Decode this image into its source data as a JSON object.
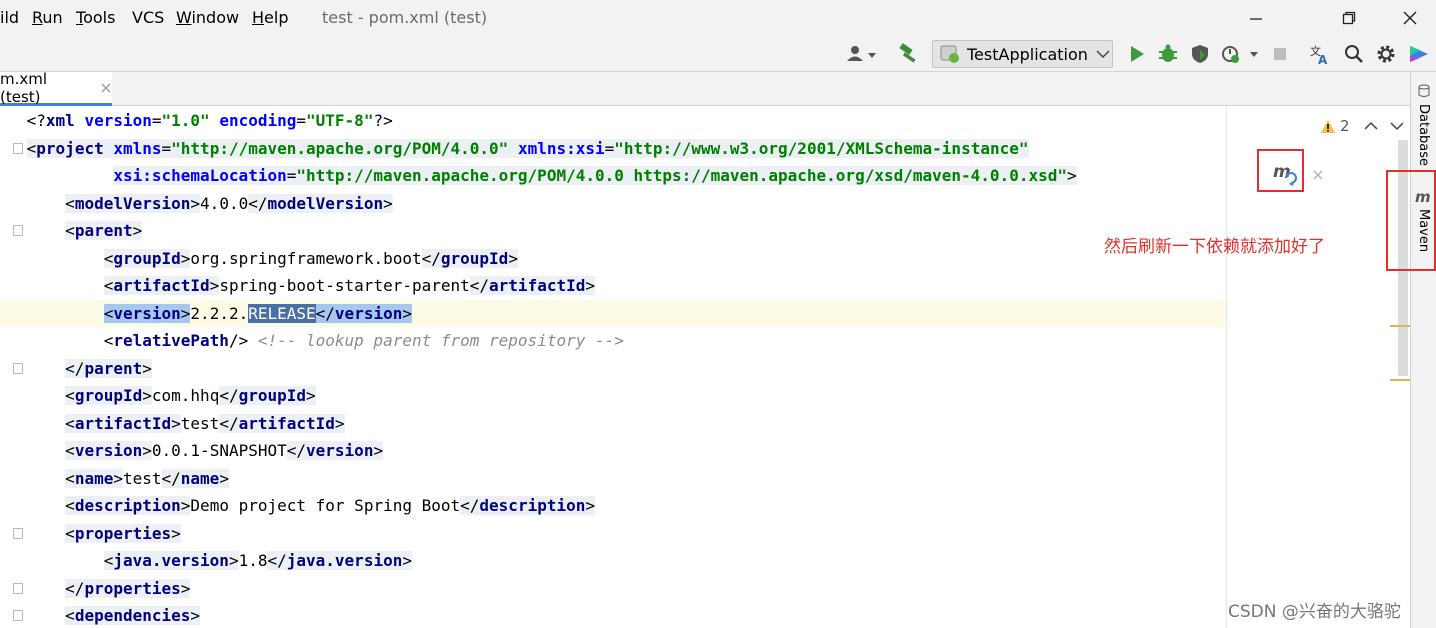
{
  "menubar": {
    "items": [
      {
        "text": "ild",
        "u": ""
      },
      {
        "text": "Run",
        "u": "R"
      },
      {
        "text": "Tools",
        "u": "T"
      },
      {
        "text": "VCS",
        "u": ""
      },
      {
        "text": "Window",
        "u": "W"
      },
      {
        "text": "Help",
        "u": "H"
      }
    ],
    "window_title": "test - pom.xml (test)"
  },
  "toolbar": {
    "run_config": "TestApplication"
  },
  "tab": {
    "label": "m.xml (test)"
  },
  "inspection": {
    "count": "2"
  },
  "right_strip": {
    "database": "Database",
    "maven": "Maven"
  },
  "annotation": "然后刷新一下依赖就添加好了",
  "watermark": "CSDN @兴奋的大骆驼",
  "colors": {
    "accent": "#4083c9",
    "annotation": "#e0302c",
    "tag": "#000080",
    "attr": "#0000ff",
    "value": "#008000"
  },
  "code_lines": [
    {
      "indent": "",
      "segments": [
        {
          "t": "<?",
          "c": "t"
        },
        {
          "t": "xml ",
          "c": "tk"
        },
        {
          "t": "version",
          "c": "an"
        },
        {
          "t": "=",
          "c": "t"
        },
        {
          "t": "\"1.0\" ",
          "c": "av"
        },
        {
          "t": "encoding",
          "c": "an"
        },
        {
          "t": "=",
          "c": "t"
        },
        {
          "t": "\"UTF-8\"",
          "c": "av"
        },
        {
          "t": "?>",
          "c": "t"
        }
      ]
    },
    {
      "indent": "",
      "segments": [
        {
          "t": "<",
          "c": "t hl"
        },
        {
          "t": "project ",
          "c": "tk hl"
        },
        {
          "t": "xmlns",
          "c": "an hl"
        },
        {
          "t": "=",
          "c": "t hl"
        },
        {
          "t": "\"http://maven.apache.org/POM/4.0.0\" ",
          "c": "av hl"
        },
        {
          "t": "xmlns:xsi",
          "c": "an hl"
        },
        {
          "t": "=",
          "c": "t hl"
        },
        {
          "t": "\"http://www.w3.org/2001/XMLSchema-instance\"",
          "c": "av hl"
        }
      ]
    },
    {
      "indent": "         ",
      "segments": [
        {
          "t": "xsi:schemaLocation",
          "c": "an hl"
        },
        {
          "t": "=",
          "c": "t hl"
        },
        {
          "t": "\"http://maven.apache.org/POM/4.0.0 https://maven.apache.org/xsd/maven-4.0.0.xsd\"",
          "c": "av hl"
        },
        {
          "t": ">",
          "c": "t hl"
        }
      ]
    },
    {
      "indent": "    ",
      "segments": [
        {
          "t": "<",
          "c": "t hl"
        },
        {
          "t": "modelVersion",
          "c": "tk hl"
        },
        {
          "t": ">",
          "c": "t hl"
        },
        {
          "t": "4.0.0",
          "c": "t"
        },
        {
          "t": "</",
          "c": "t hl"
        },
        {
          "t": "modelVersion",
          "c": "tk hl"
        },
        {
          "t": ">",
          "c": "t hl"
        }
      ]
    },
    {
      "indent": "    ",
      "segments": [
        {
          "t": "<",
          "c": "t hl"
        },
        {
          "t": "parent",
          "c": "tk hl"
        },
        {
          "t": ">",
          "c": "t hl"
        }
      ]
    },
    {
      "indent": "        ",
      "segments": [
        {
          "t": "<",
          "c": "t hl"
        },
        {
          "t": "groupId",
          "c": "tk hl"
        },
        {
          "t": ">",
          "c": "t hl"
        },
        {
          "t": "org.springframework.boot",
          "c": "t"
        },
        {
          "t": "</",
          "c": "t hl"
        },
        {
          "t": "groupId",
          "c": "tk hl"
        },
        {
          "t": ">",
          "c": "t hl"
        }
      ]
    },
    {
      "indent": "        ",
      "segments": [
        {
          "t": "<",
          "c": "t hl"
        },
        {
          "t": "artifactId",
          "c": "tk hl"
        },
        {
          "t": ">",
          "c": "t hl"
        },
        {
          "t": "spring-boot-starter-parent",
          "c": "t"
        },
        {
          "t": "</",
          "c": "t hl"
        },
        {
          "t": "artifactId",
          "c": "tk hl"
        },
        {
          "t": ">",
          "c": "t hl"
        }
      ]
    },
    {
      "indent": "        ",
      "cur": true,
      "segments": [
        {
          "t": "<",
          "c": "t sel"
        },
        {
          "t": "version",
          "c": "tk sel"
        },
        {
          "t": ">",
          "c": "t sel"
        },
        {
          "t": "2.2.2.",
          "c": "t"
        },
        {
          "t": "RELEASE",
          "c": "selv"
        },
        {
          "t": "</",
          "c": "t sel"
        },
        {
          "t": "version",
          "c": "tk sel"
        },
        {
          "t": ">",
          "c": "t sel"
        }
      ]
    },
    {
      "indent": "        ",
      "segments": [
        {
          "t": "<",
          "c": "t"
        },
        {
          "t": "relativePath",
          "c": "tk"
        },
        {
          "t": "/>",
          "c": "t"
        },
        {
          "t": " <!-- lookup parent from repository -->",
          "c": "cm"
        }
      ]
    },
    {
      "indent": "    ",
      "segments": [
        {
          "t": "</",
          "c": "t hl"
        },
        {
          "t": "parent",
          "c": "tk hl"
        },
        {
          "t": ">",
          "c": "t hl"
        }
      ]
    },
    {
      "indent": "    ",
      "segments": [
        {
          "t": "<",
          "c": "t hl"
        },
        {
          "t": "groupId",
          "c": "tk hl"
        },
        {
          "t": ">",
          "c": "t hl"
        },
        {
          "t": "com.hhq",
          "c": "t"
        },
        {
          "t": "</",
          "c": "t hl"
        },
        {
          "t": "groupId",
          "c": "tk hl"
        },
        {
          "t": ">",
          "c": "t hl"
        }
      ]
    },
    {
      "indent": "    ",
      "segments": [
        {
          "t": "<",
          "c": "t hl"
        },
        {
          "t": "artifactId",
          "c": "tk hl"
        },
        {
          "t": ">",
          "c": "t hl"
        },
        {
          "t": "test",
          "c": "t"
        },
        {
          "t": "</",
          "c": "t hl"
        },
        {
          "t": "artifactId",
          "c": "tk hl"
        },
        {
          "t": ">",
          "c": "t hl"
        }
      ]
    },
    {
      "indent": "    ",
      "segments": [
        {
          "t": "<",
          "c": "t hl"
        },
        {
          "t": "version",
          "c": "tk hl"
        },
        {
          "t": ">",
          "c": "t hl"
        },
        {
          "t": "0.0.1-SNAPSHOT",
          "c": "t"
        },
        {
          "t": "</",
          "c": "t hl"
        },
        {
          "t": "version",
          "c": "tk hl"
        },
        {
          "t": ">",
          "c": "t hl"
        }
      ]
    },
    {
      "indent": "    ",
      "segments": [
        {
          "t": "<",
          "c": "t hl"
        },
        {
          "t": "name",
          "c": "tk hl"
        },
        {
          "t": ">",
          "c": "t hl"
        },
        {
          "t": "test",
          "c": "t"
        },
        {
          "t": "</",
          "c": "t hl"
        },
        {
          "t": "name",
          "c": "tk hl"
        },
        {
          "t": ">",
          "c": "t hl"
        }
      ]
    },
    {
      "indent": "    ",
      "segments": [
        {
          "t": "<",
          "c": "t hl"
        },
        {
          "t": "description",
          "c": "tk hl"
        },
        {
          "t": ">",
          "c": "t hl"
        },
        {
          "t": "Demo project for Spring Boot",
          "c": "t"
        },
        {
          "t": "</",
          "c": "t hl"
        },
        {
          "t": "description",
          "c": "tk hl"
        },
        {
          "t": ">",
          "c": "t hl"
        }
      ]
    },
    {
      "indent": "    ",
      "segments": [
        {
          "t": "<",
          "c": "t hl"
        },
        {
          "t": "properties",
          "c": "tk hl"
        },
        {
          "t": ">",
          "c": "t hl"
        }
      ]
    },
    {
      "indent": "        ",
      "segments": [
        {
          "t": "<",
          "c": "t hl"
        },
        {
          "t": "java.version",
          "c": "tk hl"
        },
        {
          "t": ">",
          "c": "t hl"
        },
        {
          "t": "1.8",
          "c": "t"
        },
        {
          "t": "</",
          "c": "t hl"
        },
        {
          "t": "java.version",
          "c": "tk hl"
        },
        {
          "t": ">",
          "c": "t hl"
        }
      ]
    },
    {
      "indent": "    ",
      "segments": [
        {
          "t": "</",
          "c": "t hl"
        },
        {
          "t": "properties",
          "c": "tk hl"
        },
        {
          "t": ">",
          "c": "t hl"
        }
      ]
    },
    {
      "indent": "    ",
      "segments": [
        {
          "t": "<",
          "c": "t hl"
        },
        {
          "t": "dependencies",
          "c": "tk hl"
        },
        {
          "t": ">",
          "c": "t hl"
        }
      ]
    }
  ]
}
